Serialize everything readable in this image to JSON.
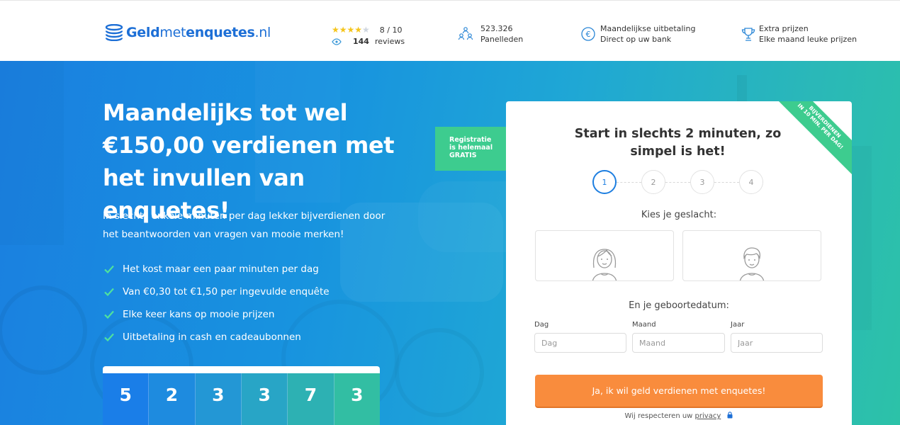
{
  "header": {
    "logo": {
      "bold": "Geld",
      "thin": "met",
      "bold2": "enquetes",
      "tld": ".nl"
    },
    "rating": {
      "stars_filled": 4,
      "stars_total": 5,
      "score": "8 / 10",
      "reviews_count": "144",
      "reviews_label": "reviews"
    },
    "panel": {
      "value": "523.326",
      "label": "Panelleden"
    },
    "payout": {
      "title": "Maandelijkse uitbetaling",
      "subtitle": "Direct op uw bank"
    },
    "prizes": {
      "title": "Extra prijzen",
      "subtitle": "Elke maand leuke prijzen"
    }
  },
  "hero": {
    "headline": [
      "Maandelijks tot wel",
      "€150,00 verdienen met",
      "het invullen van enquetes!"
    ],
    "lead": "In slechts enkele minuten per dag lekker bijverdienen door het beantwoorden van vragen van mooie merken!",
    "bullets": [
      "Het kost maar een paar minuten per dag",
      "Van €0,30 tot €1,50 per ingevulde enquête",
      "Elke keer kans op mooie prijzen",
      "Uitbetaling in cash en cadeaubonnen"
    ],
    "counter_digits": [
      "5",
      "2",
      "3",
      "3",
      "7",
      "3"
    ],
    "counter_colors": [
      "#1a7ee8",
      "#1e8bdf",
      "#2397d5",
      "#28a5c6",
      "#2db1b3",
      "#32bea3"
    ],
    "registration_ribbon": [
      "Registratie",
      "is helemaal",
      "GRATIS"
    ]
  },
  "form": {
    "corner_ribbon": [
      "BIJVERDIENEN",
      "IN 10 MIN. PER DAG!"
    ],
    "title": "Start in slechts 2 minuten, zo simpel is het!",
    "steps": [
      "1",
      "2",
      "3",
      "4"
    ],
    "active_step": 1,
    "gender_prompt": "Kies je geslacht:",
    "dob_prompt": "En je geboortedatum:",
    "day": {
      "label": "Dag",
      "placeholder": "Dag"
    },
    "month": {
      "label": "Maand",
      "placeholder": "Maand"
    },
    "year": {
      "label": "Jaar",
      "placeholder": "Jaar"
    },
    "cta": "Ja, ik wil geld verdienen met enquetes!",
    "privacy_prefix": "Wij respecteren uw",
    "privacy_link": "privacy"
  },
  "colors": {
    "brand_blue": "#1d6fd6",
    "accent_green": "#3dcc8f",
    "cta_orange": "#f98c3d",
    "star_yellow": "#f5c51c"
  }
}
